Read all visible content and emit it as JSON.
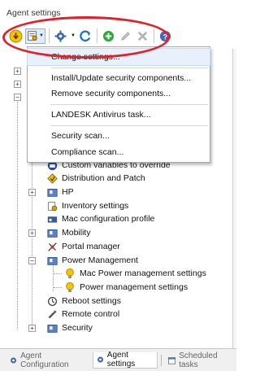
{
  "panel": {
    "title": "Agent settings"
  },
  "toolbar": {
    "buttons": [
      "lightbulb-icon",
      "settings-dropdown-icon",
      "gear-icon",
      "refresh-icon",
      "add-icon",
      "edit-icon",
      "delete-icon",
      "help-icon"
    ]
  },
  "dropdown": {
    "items": [
      {
        "label": "Change settings..."
      },
      {
        "label": "Install/Update security components..."
      },
      {
        "label": "Remove security components..."
      },
      {
        "label": "LANDESK Antivirus task..."
      },
      {
        "label": "Security scan..."
      },
      {
        "label": "Compliance scan..."
      }
    ]
  },
  "tree": {
    "items": [
      {
        "label": "Custom variables to override",
        "icon": "lock-icon"
      },
      {
        "label": "Distribution and Patch",
        "icon": "diamond-icon"
      },
      {
        "label": "HP",
        "icon": "folder-icon"
      },
      {
        "label": "Inventory settings",
        "icon": "inventory-icon"
      },
      {
        "label": "Mac configuration profile",
        "icon": "mac-icon"
      },
      {
        "label": "Mobility",
        "icon": "folder-icon"
      },
      {
        "label": "Portal manager",
        "icon": "portal-icon"
      },
      {
        "label": "Power Management",
        "icon": "folder-icon"
      },
      {
        "label": "Mac Power management settings",
        "icon": "lightbulb-icon"
      },
      {
        "label": "Power management settings",
        "icon": "lightbulb-icon"
      },
      {
        "label": "Reboot settings",
        "icon": "reboot-icon"
      },
      {
        "label": "Remote control",
        "icon": "remote-icon"
      },
      {
        "label": "Security",
        "icon": "folder-icon"
      }
    ]
  },
  "tabs": [
    {
      "label": "Agent Configuration",
      "active": false
    },
    {
      "label": "Agent settings",
      "active": true
    },
    {
      "label": "Scheduled tasks",
      "active": false
    }
  ]
}
